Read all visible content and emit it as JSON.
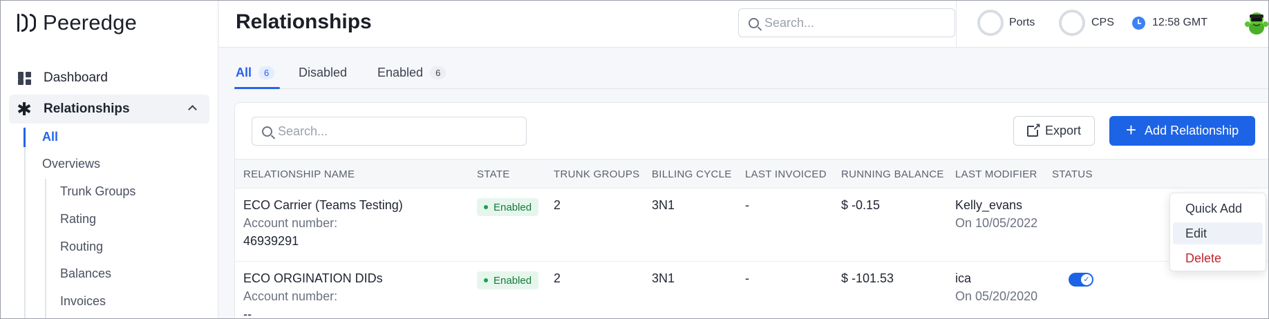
{
  "app": {
    "name": "Peeredge"
  },
  "sidebar": {
    "items": [
      {
        "label": "Dashboard"
      },
      {
        "label": "Relationships"
      }
    ],
    "relationships_sub": [
      {
        "label": "All"
      },
      {
        "label": "Overviews"
      }
    ],
    "overview_sub": [
      {
        "label": "Trunk Groups"
      },
      {
        "label": "Rating"
      },
      {
        "label": "Routing"
      },
      {
        "label": "Balances"
      },
      {
        "label": "Invoices"
      }
    ]
  },
  "header": {
    "title": "Relationships",
    "search_placeholder": "Search...",
    "ports_label": "Ports",
    "cps_label": "CPS",
    "time": "12:58 GMT"
  },
  "tabs": [
    {
      "label": "All",
      "count": "6"
    },
    {
      "label": "Disabled"
    },
    {
      "label": "Enabled",
      "count": "6"
    }
  ],
  "toolbar": {
    "search_placeholder": "Search...",
    "export_label": "Export",
    "add_label": "Add Relationship"
  },
  "table": {
    "columns": [
      "RELATIONSHIP NAME",
      "STATE",
      "TRUNK GROUPS",
      "BILLING CYCLE",
      "LAST INVOICED",
      "RUNNING BALANCE",
      "LAST MODIFIER",
      "STATUS"
    ],
    "rows": [
      {
        "name": "ECO Carrier (Teams Testing)",
        "account_label": "Account number:",
        "account_number": "46939291",
        "state": "Enabled",
        "trunk_groups": "2",
        "billing_cycle": "3N1",
        "last_invoiced": "-",
        "running_balance": "$ -0.15",
        "modifier": "Kelly_evans",
        "modified_on": "On 10/05/2022"
      },
      {
        "name": "ECO ORGINATION DIDs",
        "account_label": "Account number:",
        "account_number": "--",
        "state": "Enabled",
        "trunk_groups": "2",
        "billing_cycle": "3N1",
        "last_invoiced": "-",
        "running_balance": "$ -101.53",
        "modifier": "ica",
        "modified_on": "On 05/20/2020"
      }
    ]
  },
  "context_menu": [
    {
      "label": "Quick Add"
    },
    {
      "label": "Edit"
    },
    {
      "label": "Delete"
    }
  ],
  "colors": {
    "accent": "#1d63e5",
    "enabled_badge_bg": "#e7f6ec",
    "enabled_badge_text": "#137a3a",
    "delete": "#c0262d"
  }
}
